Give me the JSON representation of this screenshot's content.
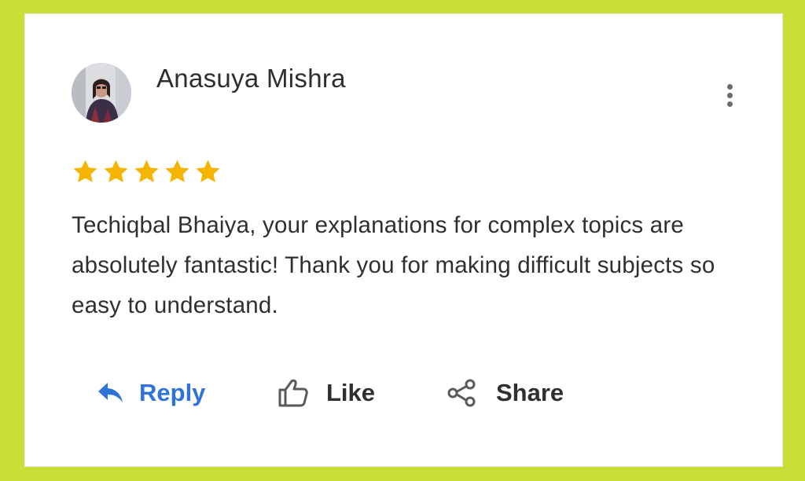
{
  "review": {
    "author_name": "Anasuya Mishra",
    "rating": 5,
    "max_rating": 5,
    "text": "Techiqbal Bhaiya, your explanations for complex topics are absolutely fantastic! Thank you for making difficult subjects so easy to understand."
  },
  "actions": {
    "reply_label": "Reply",
    "like_label": "Like",
    "share_label": "Share"
  },
  "icons": {
    "more": "more-vertical-icon",
    "reply": "reply-arrow-icon",
    "like": "thumbs-up-icon",
    "share": "share-icon",
    "star": "star-icon"
  },
  "colors": {
    "page_background": "#c8df36",
    "card_background": "#ffffff",
    "star": "#f4b400",
    "reply": "#2f73d8",
    "text": "#2f2f2f"
  }
}
